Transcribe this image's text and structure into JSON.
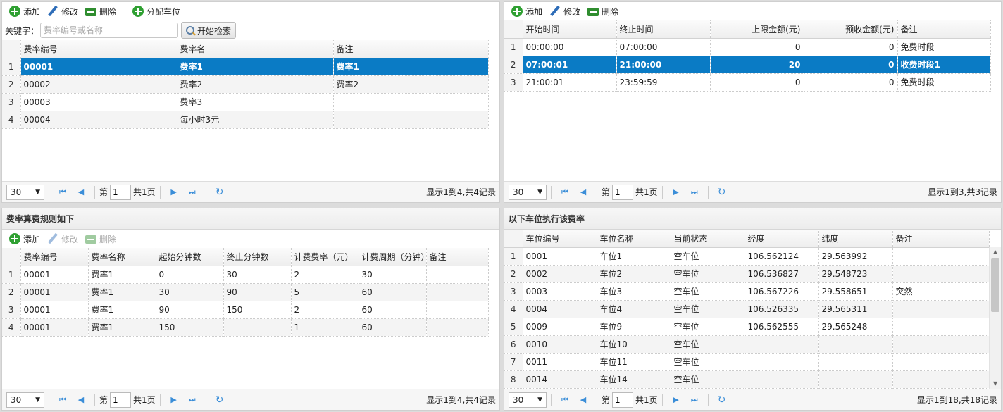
{
  "rates_panel": {
    "toolbar": {
      "add": "添加",
      "edit": "修改",
      "delete": "删除",
      "assign": "分配车位"
    },
    "search": {
      "label": "关键字：",
      "placeholder": "费率编号或名称",
      "button": "开始检索"
    },
    "columns": [
      "费率编号",
      "费率名",
      "备注"
    ],
    "rows": [
      {
        "n": "1",
        "cells": [
          "00001",
          "费率1",
          "费率1"
        ],
        "selected": true
      },
      {
        "n": "2",
        "cells": [
          "00002",
          "费率2",
          "费率2"
        ]
      },
      {
        "n": "3",
        "cells": [
          "00003",
          "费率3",
          ""
        ]
      },
      {
        "n": "4",
        "cells": [
          "00004",
          "每小时3元",
          ""
        ]
      }
    ],
    "pager": {
      "page_size": "30",
      "page_prefix": "第",
      "page": "1",
      "total_pages": "共1页",
      "info": "显示1到4,共4记录"
    }
  },
  "periods_panel": {
    "toolbar": {
      "add": "添加",
      "edit": "修改",
      "delete": "删除"
    },
    "columns": [
      "开始时间",
      "终止时间",
      "上限金额(元)",
      "预收金额(元)",
      "备注"
    ],
    "rows": [
      {
        "n": "1",
        "cells": [
          "00:00:00",
          "07:00:00",
          "0",
          "0",
          "免费时段"
        ]
      },
      {
        "n": "2",
        "cells": [
          "07:00:01",
          "21:00:00",
          "20",
          "0",
          "收费时段1"
        ],
        "selected": true
      },
      {
        "n": "3",
        "cells": [
          "21:00:01",
          "23:59:59",
          "0",
          "0",
          "免费时段"
        ]
      }
    ],
    "pager": {
      "page_size": "30",
      "page_prefix": "第",
      "page": "1",
      "total_pages": "共1页",
      "info": "显示1到3,共3记录"
    }
  },
  "rules_panel": {
    "title": "费率算费规则如下",
    "toolbar": {
      "add": "添加",
      "edit": "修改",
      "delete": "删除"
    },
    "columns": [
      "费率编号",
      "费率名称",
      "起始分钟数",
      "终止分钟数",
      "计费费率（元）",
      "计费周期（分钟）",
      "备注"
    ],
    "rows": [
      {
        "n": "1",
        "cells": [
          "00001",
          "费率1",
          "0",
          "30",
          "2",
          "30",
          ""
        ]
      },
      {
        "n": "2",
        "cells": [
          "00001",
          "费率1",
          "30",
          "90",
          "5",
          "60",
          ""
        ]
      },
      {
        "n": "3",
        "cells": [
          "00001",
          "费率1",
          "90",
          "150",
          "2",
          "60",
          ""
        ]
      },
      {
        "n": "4",
        "cells": [
          "00001",
          "费率1",
          "150",
          "",
          "1",
          "60",
          ""
        ]
      }
    ],
    "pager": {
      "page_size": "30",
      "page_prefix": "第",
      "page": "1",
      "total_pages": "共1页",
      "info": "显示1到4,共4记录"
    }
  },
  "spaces_panel": {
    "title": "以下车位执行该费率",
    "columns": [
      "车位编号",
      "车位名称",
      "当前状态",
      "经度",
      "纬度",
      "备注"
    ],
    "rows": [
      {
        "n": "1",
        "cells": [
          "0001",
          "车位1",
          "空车位",
          "106.562124",
          "29.563992",
          ""
        ]
      },
      {
        "n": "2",
        "cells": [
          "0002",
          "车位2",
          "空车位",
          "106.536827",
          "29.548723",
          ""
        ]
      },
      {
        "n": "3",
        "cells": [
          "0003",
          "车位3",
          "空车位",
          "106.567226",
          "29.558651",
          "突然"
        ]
      },
      {
        "n": "4",
        "cells": [
          "0004",
          "车位4",
          "空车位",
          "106.526335",
          "29.565311",
          ""
        ]
      },
      {
        "n": "5",
        "cells": [
          "0009",
          "车位9",
          "空车位",
          "106.562555",
          "29.565248",
          ""
        ]
      },
      {
        "n": "6",
        "cells": [
          "0010",
          "车位10",
          "空车位",
          "",
          "",
          ""
        ]
      },
      {
        "n": "7",
        "cells": [
          "0011",
          "车位11",
          "空车位",
          "",
          "",
          ""
        ]
      },
      {
        "n": "8",
        "cells": [
          "0014",
          "车位14",
          "空车位",
          "",
          "",
          ""
        ]
      }
    ],
    "pager": {
      "page_size": "30",
      "page_prefix": "第",
      "page": "1",
      "total_pages": "共1页",
      "info": "显示1到18,共18记录"
    }
  },
  "colors": {
    "selected_row": "#0a7bc5",
    "pager_icon": "#3b8ed8",
    "add_icon": "#2fa032",
    "edit_icon": "#2e6db8"
  }
}
